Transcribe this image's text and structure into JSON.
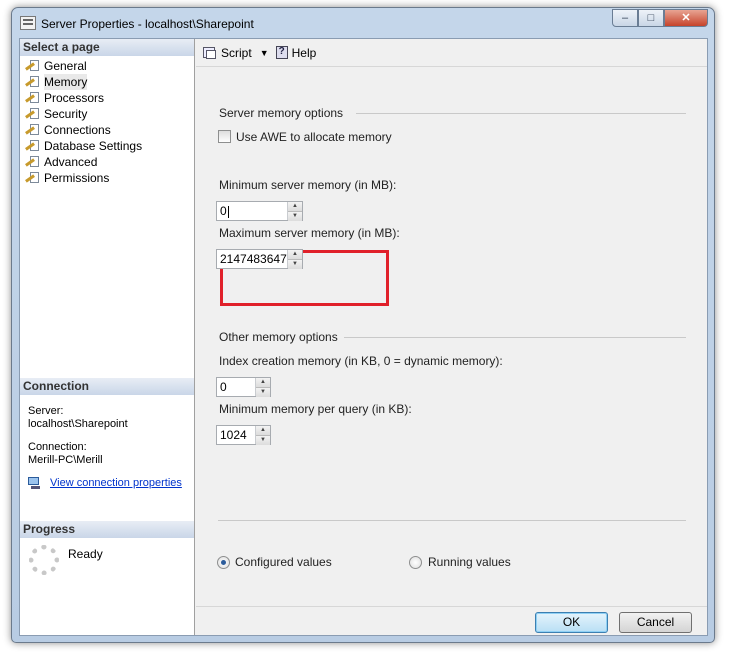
{
  "window": {
    "title": "Server Properties - localhost\\Sharepoint"
  },
  "caption_buttons": {
    "minimize": "–",
    "maximize": "□",
    "close": "✕"
  },
  "left_panel": {
    "select_page_header": "Select a page",
    "pages": [
      "General",
      "Memory",
      "Processors",
      "Security",
      "Connections",
      "Database Settings",
      "Advanced",
      "Permissions"
    ],
    "selected_page": "Memory",
    "connection_header": "Connection",
    "server_label": "Server:",
    "server_value": "localhost\\Sharepoint",
    "connection_label": "Connection:",
    "connection_value": "Merill-PC\\Merill",
    "view_link": "View connection properties",
    "progress_header": "Progress",
    "progress_status": "Ready"
  },
  "toolbar": {
    "script_label": "Script",
    "dropdown_arrow": "▼",
    "help_label": "Help"
  },
  "server_memory": {
    "group_title": "Server memory options",
    "use_awe_label": "Use AWE to allocate memory",
    "use_awe_checked": false,
    "min_label": "Minimum server memory (in MB):",
    "min_value": "0",
    "max_label": "Maximum server memory (in MB):",
    "max_value": "2147483647"
  },
  "other_memory": {
    "group_title": "Other memory options",
    "index_label": "Index creation memory (in KB, 0 = dynamic memory):",
    "index_value": "0",
    "min_query_label": "Minimum memory per query (in KB):",
    "min_query_value": "1024"
  },
  "spin_glyphs": {
    "up": "▲",
    "down": "▼"
  },
  "values_mode": {
    "configured_label": "Configured values",
    "running_label": "Running values",
    "selected": "configured"
  },
  "buttons": {
    "ok": "OK",
    "cancel": "Cancel"
  },
  "colors": {
    "highlight_box": "#e0202a",
    "link": "#0033cc"
  }
}
